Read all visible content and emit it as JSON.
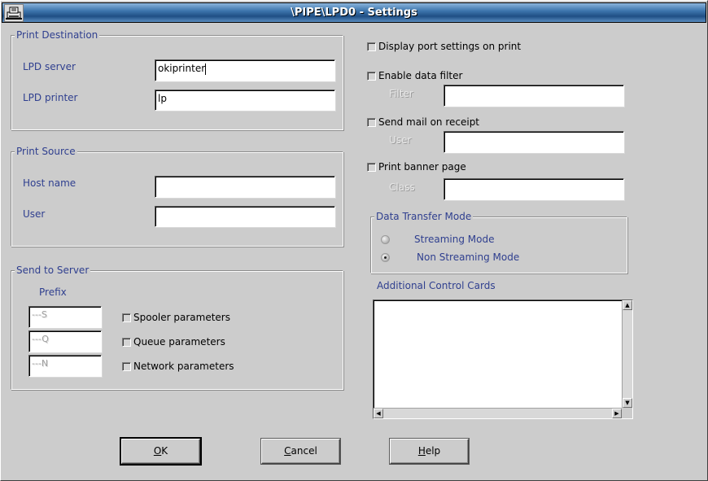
{
  "window": {
    "title": "\\PIPE\\LPD0 - Settings"
  },
  "print_destination": {
    "title": "Print Destination",
    "lpd_server_label": "LPD server",
    "lpd_server_value": "okiprinter",
    "lpd_printer_label": "LPD printer",
    "lpd_printer_value": "lp"
  },
  "print_source": {
    "title": "Print Source",
    "host_name_label": "Host name",
    "host_name_value": "",
    "user_label": "User",
    "user_value": ""
  },
  "send_to_server": {
    "title": "Send to Server",
    "prefix_label": "Prefix",
    "rows": [
      {
        "prefix": "---S",
        "label": "Spooler parameters",
        "checked": false
      },
      {
        "prefix": "---Q",
        "label": "Queue parameters",
        "checked": false
      },
      {
        "prefix": "---N",
        "label": "Network parameters",
        "checked": false
      }
    ]
  },
  "options": {
    "display_port_settings": {
      "label": "Display port settings on print",
      "checked": false
    },
    "enable_data_filter": {
      "label": "Enable data filter",
      "checked": false
    },
    "filter_label": "Filter",
    "filter_value": "",
    "send_mail": {
      "label": "Send mail on receipt",
      "checked": false
    },
    "user_label": "User",
    "user_value": "",
    "print_banner": {
      "label": "Print banner page",
      "checked": false
    },
    "class_label": "Class",
    "class_value": ""
  },
  "data_transfer_mode": {
    "title": "Data Transfer Mode",
    "options": [
      {
        "label": "Streaming Mode",
        "selected": false
      },
      {
        "label": "Non Streaming Mode",
        "selected": true
      }
    ]
  },
  "additional_control_cards": {
    "label": "Additional Control Cards",
    "value": ""
  },
  "buttons": {
    "ok": {
      "mnemonic": "O",
      "rest": "K"
    },
    "cancel": {
      "mnemonic": "C",
      "rest": "ancel"
    },
    "help": {
      "mnemonic": "H",
      "rest": "elp"
    }
  },
  "icons": {
    "window_icon": "printer-icon",
    "scroll_up": "up-arrow-icon",
    "scroll_down": "down-arrow-icon",
    "scroll_left": "left-arrow-icon",
    "scroll_right": "right-arrow-icon"
  }
}
